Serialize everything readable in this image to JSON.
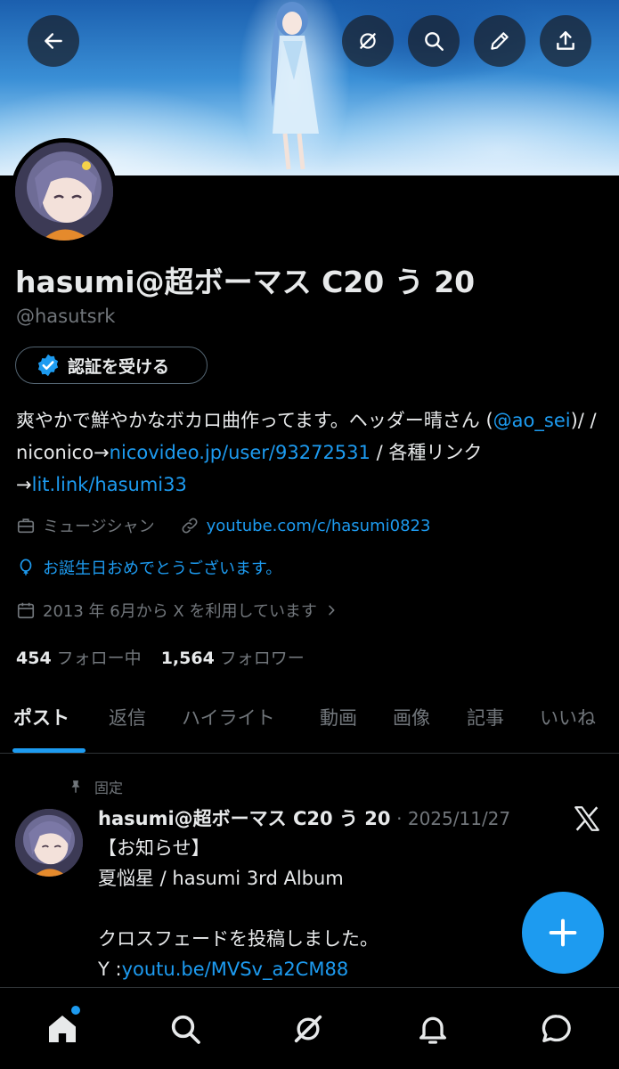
{
  "header": {
    "back_icon": "arrow-left-icon",
    "actions": [
      "grok-icon",
      "search-icon",
      "edit-icon",
      "share-icon"
    ]
  },
  "profile": {
    "display_name": "hasumi@超ボーマス C20 う 20",
    "handle": "@hasutsrk",
    "verify_label": "認証を受ける",
    "bio": {
      "text1": "爽やかで鮮やかなボカロ曲作ってます。ヘッダー晴さん (",
      "mention": "@ao_sei",
      "text2": ")/ / niconico→",
      "nico_link": "nicovideo.jp/user/93272531",
      "text3": " / 各種リンク →",
      "litlink": "lit.link/hasumi33"
    },
    "category": "ミュージシャン",
    "website": "youtube.com/c/hasumi0823",
    "birthday": "お誕生日おめでとうございます。",
    "joined": "2013 年 6月から X を利用しています",
    "following_count": "454",
    "following_label": "フォロー中",
    "followers_count": "1,564",
    "followers_label": "フォロワー"
  },
  "tabs": [
    "ポスト",
    "返信",
    "ハイライト",
    "動画",
    "画像",
    "記事",
    "いいね"
  ],
  "active_tab": 0,
  "post": {
    "pinned_label": "固定",
    "author": "hasumi@超ボーマス C20 う 20",
    "time": "· 2025/11/27",
    "lines": [
      "【お知らせ】",
      "夏悩星 / hasumi 3rd Album",
      "",
      "クロスフェードを投稿しました。"
    ],
    "link_prefix": "Y :",
    "link": "youtu.be/MVSv_a2CM88"
  },
  "nav": [
    "home-icon",
    "search-icon",
    "grok-icon",
    "notifications-icon",
    "messages-icon"
  ],
  "colors": {
    "accent": "#1d9bf0",
    "muted": "#71767b",
    "text": "#e7e9ea",
    "background": "#000000"
  }
}
